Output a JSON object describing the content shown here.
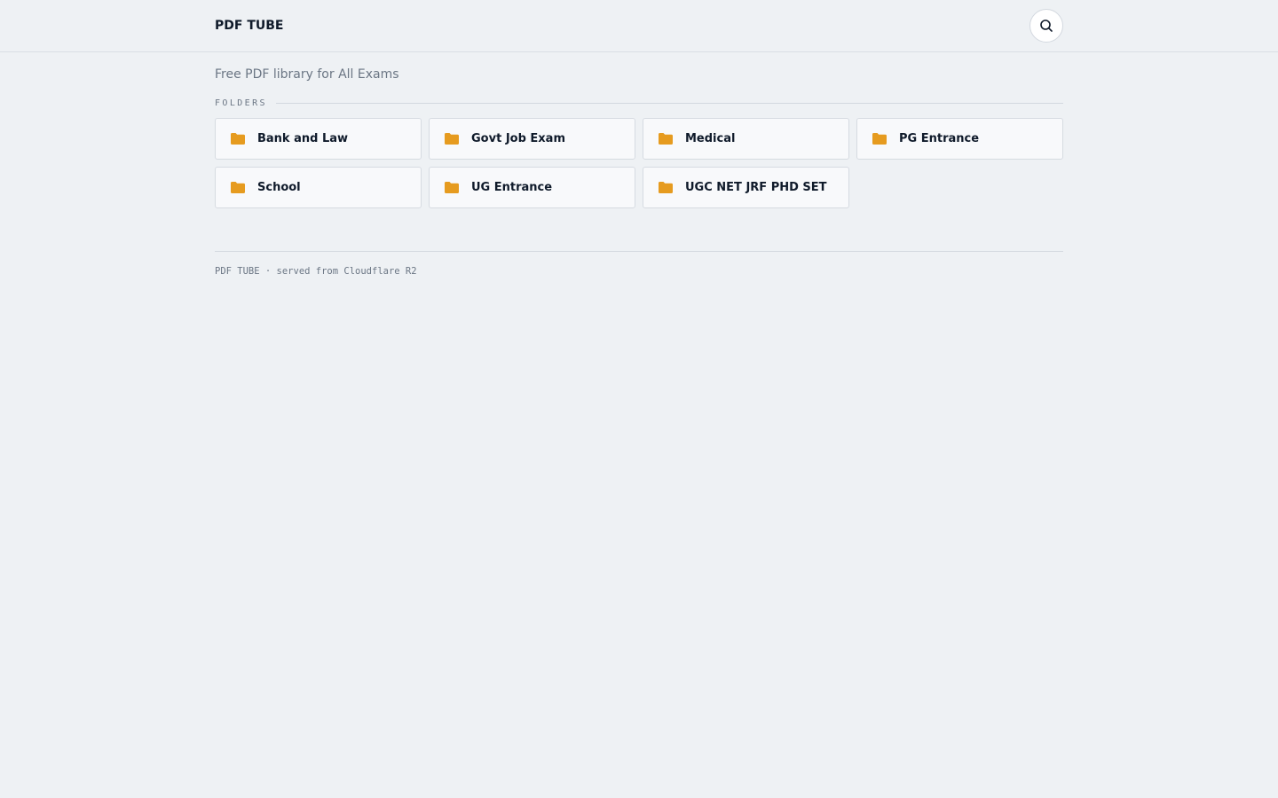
{
  "header": {
    "brand": "PDF TUBE",
    "search_icon": "search-icon"
  },
  "main": {
    "tagline": "Free PDF library for All Exams",
    "section_label": "FOLDERS",
    "folders": [
      {
        "label": "Bank and Law",
        "icon": "folder-icon"
      },
      {
        "label": "Govt Job Exam",
        "icon": "folder-icon"
      },
      {
        "label": "Medical",
        "icon": "folder-icon"
      },
      {
        "label": "PG Entrance",
        "icon": "folder-icon"
      },
      {
        "label": "School",
        "icon": "folder-icon"
      },
      {
        "label": "UG Entrance",
        "icon": "folder-icon"
      },
      {
        "label": "UGC NET JRF PHD SET",
        "icon": "folder-icon"
      }
    ]
  },
  "footer": {
    "text": "PDF TUBE · served from Cloudflare R2"
  },
  "colors": {
    "background": "#eef1f4",
    "folder_accent": "#e69b1f",
    "text_primary": "#0f1a2a",
    "text_muted": "#6b7684"
  }
}
